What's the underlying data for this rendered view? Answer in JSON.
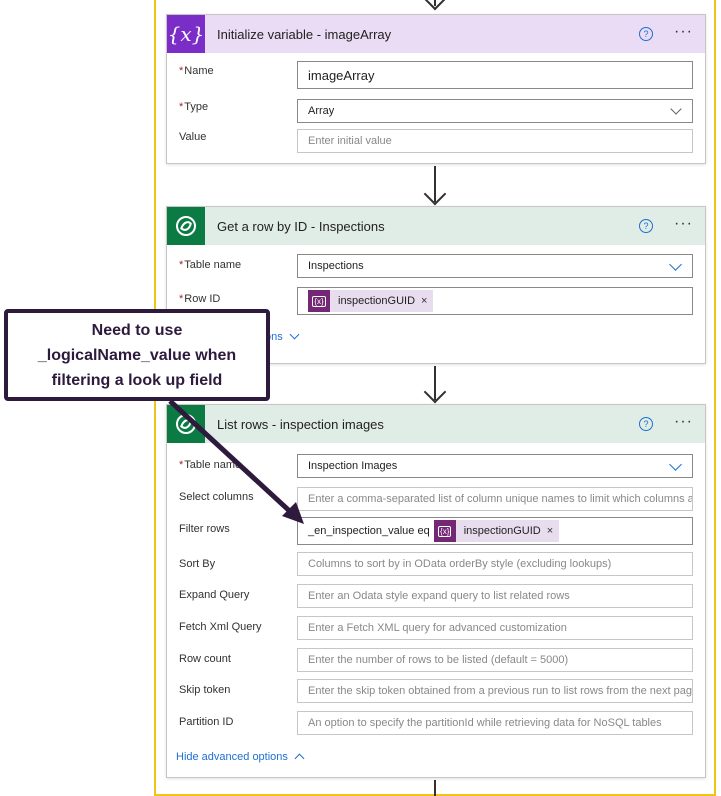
{
  "init_variable": {
    "title": "Initialize variable - imageArray",
    "icon": "variable-icon",
    "fields": {
      "name_label": "Name",
      "name_value": "imageArray",
      "type_label": "Type",
      "type_value": "Array",
      "value_label": "Value",
      "value_placeholder": "Enter initial value"
    }
  },
  "get_row": {
    "title": "Get a row by ID - Inspections",
    "icon": "dataverse-icon",
    "fields": {
      "table_label": "Table name",
      "table_value": "Inspections",
      "rowid_label": "Row ID",
      "rowid_token": "inspectionGUID",
      "advanced_partial": "ons"
    }
  },
  "list_rows": {
    "title": "List rows - inspection images",
    "icon": "dataverse-icon",
    "fields": {
      "table_label": "Table name",
      "table_value": "Inspection Images",
      "select_label": "Select columns",
      "select_placeholder": "Enter a comma-separated list of column unique names to limit which columns a",
      "filter_label": "Filter rows",
      "filter_text": "_en_inspection_value eq",
      "filter_token": "inspectionGUID",
      "sort_label": "Sort By",
      "sort_placeholder": "Columns to sort by in OData orderBy style (excluding lookups)",
      "expand_label": "Expand Query",
      "expand_placeholder": "Enter an Odata style expand query to list related rows",
      "fetch_label": "Fetch Xml Query",
      "fetch_placeholder": "Enter a Fetch XML query for advanced customization",
      "rowcount_label": "Row count",
      "rowcount_placeholder": "Enter the number of rows to be listed (default = 5000)",
      "skip_label": "Skip token",
      "skip_placeholder": "Enter the skip token obtained from a previous run to list rows from the next pag",
      "partition_label": "Partition ID",
      "partition_placeholder": "An option to specify the partitionId while retrieving data for NoSQL tables",
      "hide_advanced": "Hide advanced options"
    }
  },
  "common": {
    "required_mark": "*",
    "help_glyph": "?",
    "more_glyph": "···",
    "close_glyph": "×",
    "token_glyph": "{x}"
  },
  "callout": {
    "text": "Need to use\n_logicalName_value when\nfiltering a look up field"
  },
  "colors": {
    "scope_border": "#f0c419",
    "variable_accent": "#7b2ec7",
    "dataverse_accent": "#0b7a43",
    "token_bg": "#742774",
    "link": "#1f6fd1",
    "callout": "#2d1a3d"
  }
}
